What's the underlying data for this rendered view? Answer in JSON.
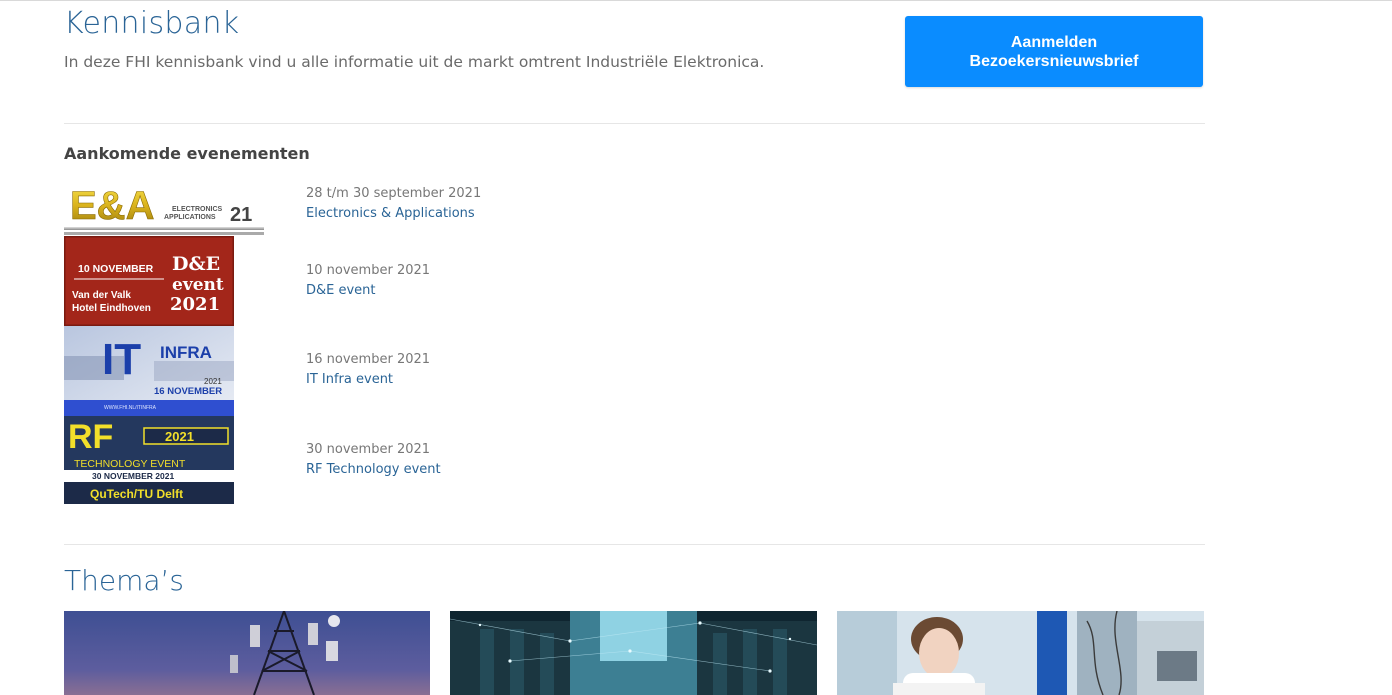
{
  "header": {
    "title": "Kennisbank",
    "intro": "In deze FHI kennisbank vind u alle informatie uit de markt omtrent Industriële Elektronica."
  },
  "cta": {
    "line1": "Aanmelden",
    "line2": "Bezoekersnieuwsbrief",
    "color": "#0a8cff"
  },
  "events": {
    "heading": "Aankomende evenementen",
    "items": [
      {
        "date": "28 t/m 30 september 2021",
        "name": "Electronics & Applications",
        "logo": {
          "main": "E&A",
          "sub1": "ELECTRONICS",
          "sub2": "APPLICATIONS",
          "year": "21"
        }
      },
      {
        "date": "10 november 2021",
        "name": "D&E event",
        "logo": {
          "day": "10 NOVEMBER",
          "brand": "D&E",
          "word": "event",
          "year": "2021",
          "venue1": "Van der Valk",
          "venue2": "Hotel Eindhoven"
        }
      },
      {
        "date": "16 november 2021",
        "name": "IT Infra event",
        "logo": {
          "it": "IT",
          "word": "INFRA",
          "year": "2021",
          "day": "16 NOVEMBER",
          "url": "WWW.FHI.NL/ITINFRA"
        }
      },
      {
        "date": "30 november 2021",
        "name": "RF Technology event",
        "logo": {
          "rf": "RF",
          "year": "2021",
          "word": "TECHNOLOGY EVENT",
          "day": "30 NOVEMBER 2021",
          "venue": "QuTech/TU Delft"
        }
      }
    ]
  },
  "themes": {
    "title": "Thema’s",
    "cards": [
      {
        "icon": "telecom-tower-photo"
      },
      {
        "icon": "datacenter-photo"
      },
      {
        "icon": "lab-technician-photo"
      }
    ]
  },
  "colors": {
    "accent_blue": "#2a6496",
    "button_blue": "#0a8cff",
    "de_red": "#a3261a",
    "rf_navy": "#1c2a48"
  }
}
